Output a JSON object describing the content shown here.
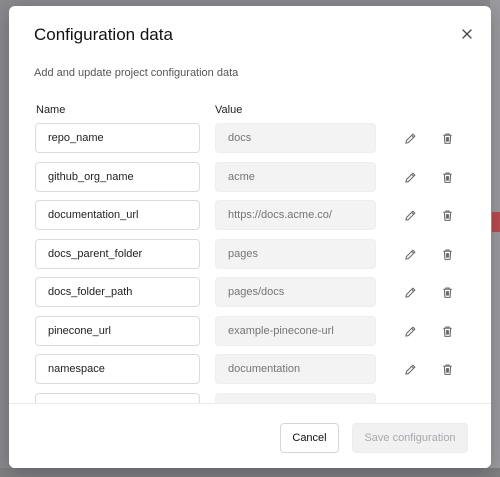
{
  "modal": {
    "title": "Configuration data",
    "subtitle": "Add and update project configuration data",
    "columns": {
      "name": "Name",
      "value": "Value"
    },
    "rows": [
      {
        "name": "repo_name",
        "value_placeholder": "docs"
      },
      {
        "name": "github_org_name",
        "value_placeholder": "acme"
      },
      {
        "name": "documentation_url",
        "value_placeholder": "https://docs.acme.co/"
      },
      {
        "name": "docs_parent_folder",
        "value_placeholder": "pages"
      },
      {
        "name": "docs_folder_path",
        "value_placeholder": "pages/docs"
      },
      {
        "name": "pinecone_url",
        "value_placeholder": "example-pinecone-url"
      },
      {
        "name": "namespace",
        "value_placeholder": "documentation"
      },
      {
        "name": "",
        "value_placeholder": ""
      }
    ],
    "footer": {
      "cancel_label": "Cancel",
      "save_label": "Save configuration"
    }
  },
  "icons": {
    "close": "close-icon",
    "edit": "pencil-icon",
    "delete": "trash-icon"
  },
  "colors": {
    "backdrop": "#8a8a8e",
    "modal_bg": "#ffffff",
    "disabled_text": "#a9a9ad"
  }
}
